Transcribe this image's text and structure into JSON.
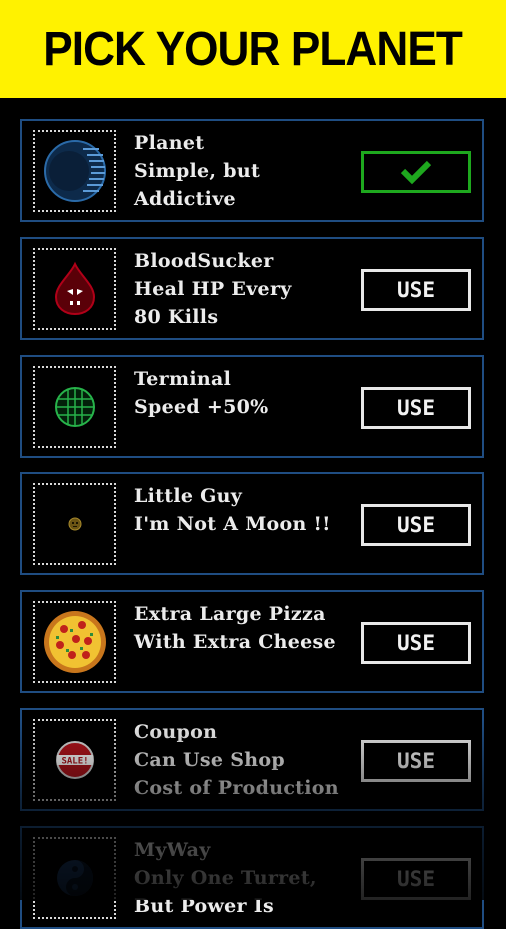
{
  "header": {
    "title": "PICK YOUR PLANET"
  },
  "planets": [
    {
      "icon": "blue-planet-icon",
      "lines": [
        "Planet",
        "Simple, but",
        "Addictive"
      ],
      "button": "",
      "selected": true
    },
    {
      "icon": "blood-drop-icon",
      "lines": [
        "BloodSucker",
        "Heal HP Every",
        "80 Kills"
      ],
      "button": "USE",
      "selected": false
    },
    {
      "icon": "green-globe-icon",
      "lines": [
        "Terminal",
        "Speed +50%"
      ],
      "button": "USE",
      "selected": false
    },
    {
      "icon": "small-face-icon",
      "lines": [
        "Little Guy",
        "I'm Not A Moon !!"
      ],
      "button": "USE",
      "selected": false
    },
    {
      "icon": "pizza-icon",
      "lines": [
        "Extra Large Pizza",
        "With Extra Cheese"
      ],
      "button": "USE",
      "selected": false
    },
    {
      "icon": "sale-coupon-icon",
      "lines": [
        "Coupon",
        "Can Use Shop",
        "Cost of Production"
      ],
      "button": "USE",
      "selected": false
    },
    {
      "icon": "yin-yang-icon",
      "lines": [
        "MyWay",
        "Only One Turret,",
        "But Power Is"
      ],
      "button": "USE",
      "selected": false
    }
  ],
  "icons": {
    "selected": "checkmark-icon"
  },
  "colors": {
    "banner": "#fff200",
    "card_border": "#1f4d82",
    "selected_border": "#1ea81e",
    "check": "#1ea81e"
  }
}
